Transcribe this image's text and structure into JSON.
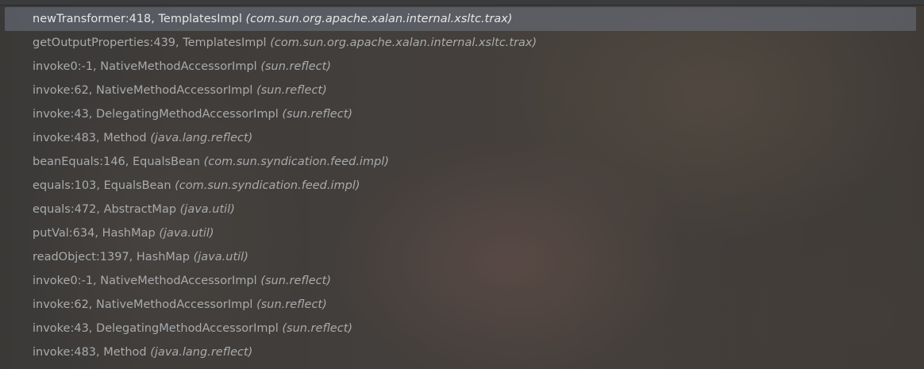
{
  "frames_panel": {
    "frames": [
      {
        "method": "newTransformer:418, TemplatesImpl",
        "package": "(com.sun.org.apache.xalan.internal.xsltc.trax)",
        "selected": true
      },
      {
        "method": "getOutputProperties:439, TemplatesImpl",
        "package": "(com.sun.org.apache.xalan.internal.xsltc.trax)"
      },
      {
        "method": "invoke0:-1, NativeMethodAccessorImpl",
        "package": "(sun.reflect)"
      },
      {
        "method": "invoke:62, NativeMethodAccessorImpl",
        "package": "(sun.reflect)"
      },
      {
        "method": "invoke:43, DelegatingMethodAccessorImpl",
        "package": "(sun.reflect)"
      },
      {
        "method": "invoke:483, Method",
        "package": "(java.lang.reflect)"
      },
      {
        "method": "beanEquals:146, EqualsBean",
        "package": "(com.sun.syndication.feed.impl)"
      },
      {
        "method": "equals:103, EqualsBean",
        "package": "(com.sun.syndication.feed.impl)"
      },
      {
        "method": "equals:472, AbstractMap",
        "package": "(java.util)"
      },
      {
        "method": "putVal:634, HashMap",
        "package": "(java.util)"
      },
      {
        "method": "readObject:1397, HashMap",
        "package": "(java.util)"
      },
      {
        "method": "invoke0:-1, NativeMethodAccessorImpl",
        "package": "(sun.reflect)"
      },
      {
        "method": "invoke:62, NativeMethodAccessorImpl",
        "package": "(sun.reflect)"
      },
      {
        "method": "invoke:43, DelegatingMethodAccessorImpl",
        "package": "(sun.reflect)"
      },
      {
        "method": "invoke:483, Method",
        "package": "(java.lang.reflect)"
      }
    ]
  },
  "colors": {
    "selected_row_bg": "#6e7484",
    "selected_text": "#e6e6e6",
    "frame_text": "#a8abad"
  }
}
